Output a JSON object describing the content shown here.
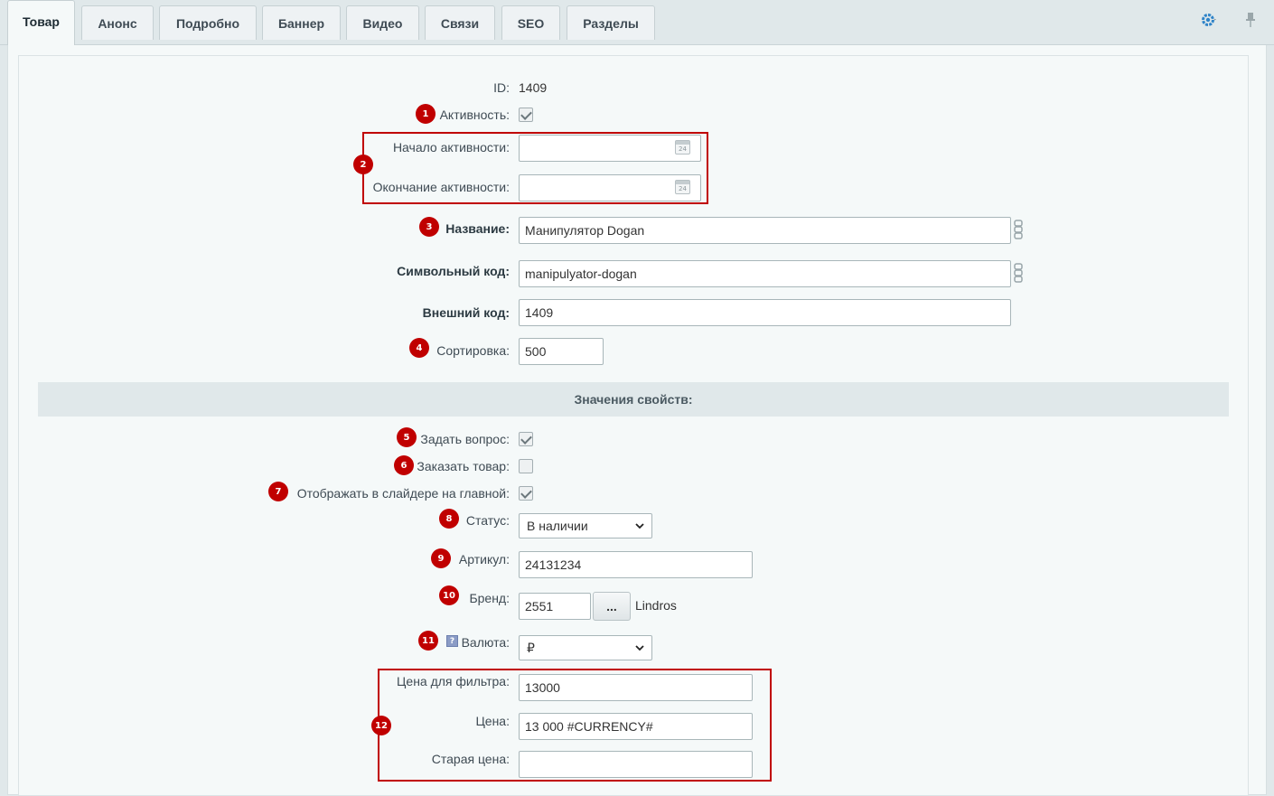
{
  "tabs": [
    "Товар",
    "Анонс",
    "Подробно",
    "Баннер",
    "Видео",
    "Связи",
    "SEO",
    "Разделы"
  ],
  "toolbar": {
    "settings_icon": "gear-icon",
    "pin_icon": "pin-icon"
  },
  "form": {
    "id_label": "ID:",
    "id_value": "1409",
    "active_label": "Активность:",
    "active_checked": true,
    "active_from_label": "Начало активности:",
    "active_from_value": "",
    "active_to_label": "Окончание активности:",
    "active_to_value": "",
    "name_label": "Название:",
    "name_value": "Манипулятор Dogan",
    "code_label": "Символьный код:",
    "code_value": "manipulyator-dogan",
    "xml_id_label": "Внешний код:",
    "xml_id_value": "1409",
    "sort_label": "Сортировка:",
    "sort_value": "500"
  },
  "section_title": "Значения свойств:",
  "props": {
    "ask_label": "Задать вопрос:",
    "ask_checked": true,
    "order_label": "Заказать товар:",
    "order_checked": false,
    "slider_label": "Отображать в слайдере на главной:",
    "slider_checked": true,
    "status_label": "Статус:",
    "status_value": "В наличии",
    "article_label": "Артикул:",
    "article_value": "24131234",
    "brand_label": "Бренд:",
    "brand_value": "2551",
    "brand_button": "...",
    "brand_name": "Lindros",
    "help_icon": "?",
    "currency_label": "Валюта:",
    "currency_value": "₽",
    "filter_price_label": "Цена для фильтра:",
    "filter_price_value": "13000",
    "price_label": "Цена:",
    "price_value": "13 000 #CURRENCY#",
    "old_price_label": "Старая цена:",
    "old_price_value": ""
  },
  "badges": [
    "1",
    "2",
    "3",
    "4",
    "5",
    "6",
    "7",
    "8",
    "9",
    "10",
    "11",
    "12"
  ],
  "accent_color": "#c00000"
}
